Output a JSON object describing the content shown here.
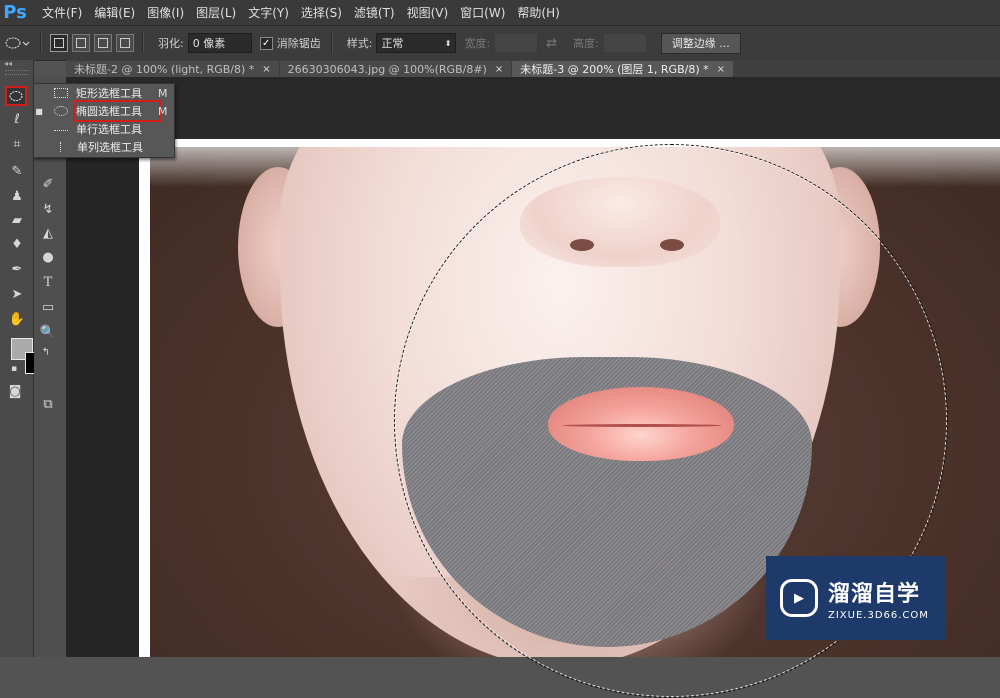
{
  "app": {
    "logo": "Ps"
  },
  "menubar": {
    "items": [
      "文件(F)",
      "编辑(E)",
      "图像(I)",
      "图层(L)",
      "文字(Y)",
      "选择(S)",
      "滤镜(T)",
      "视图(V)",
      "窗口(W)",
      "帮助(H)"
    ]
  },
  "options": {
    "feather_label": "羽化:",
    "feather_value": "0 像素",
    "antialias_label": "消除锯齿",
    "antialias_checked": true,
    "style_label": "样式:",
    "style_value": "正常",
    "width_label": "宽度:",
    "height_label": "高度:",
    "refine_button": "调整边缘 ..."
  },
  "tabs": [
    {
      "label": "未标题-2 @ 100% (light, RGB/8) *",
      "active": false
    },
    {
      "label": "26630306043.jpg @ 100%(RGB/8#)",
      "active": false
    },
    {
      "label": "未标题-3 @ 200% (图层 1, RGB/8) *",
      "active": true
    }
  ],
  "tab_close": "×",
  "flyout": {
    "items": [
      {
        "label": "矩形选框工具",
        "key": "M",
        "icon": "rect-marquee-icon",
        "selected": false
      },
      {
        "label": "椭圆选框工具",
        "key": "M",
        "icon": "ellipse-marquee-icon",
        "selected": true
      },
      {
        "label": "单行选框工具",
        "key": "",
        "icon": "single-row-marquee-icon",
        "selected": false
      },
      {
        "label": "单列选框工具",
        "key": "",
        "icon": "single-column-marquee-icon",
        "selected": false
      }
    ]
  },
  "colors": {
    "foreground": "#aaaaaa",
    "background": "#000000",
    "highlight": "#d21d1d"
  },
  "watermark": {
    "title": "溜溜自学",
    "subtitle": "ZIXUE.3D66.COM"
  }
}
